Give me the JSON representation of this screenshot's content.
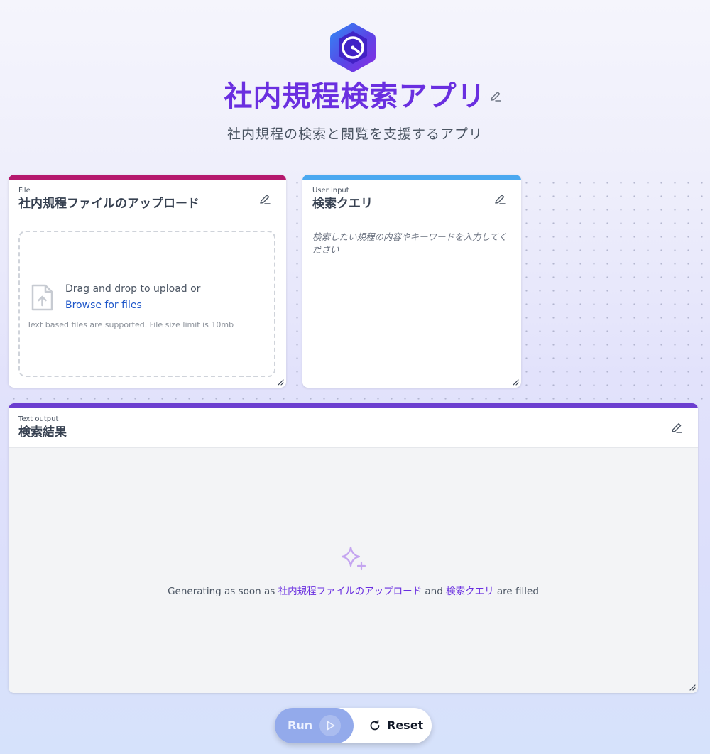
{
  "app": {
    "title": "社内規程検索アプリ",
    "subtitle": "社内規程の検索と閲覧を支援するアプリ",
    "accent": "#6a2fe0"
  },
  "file_card": {
    "kind": "File",
    "title": "社内規程ファイルのアップロード",
    "bar_color": "#b5186d",
    "drop_text": "Drag and drop to upload or",
    "browse_link": "Browse for files",
    "note": "Text based files are supported. File size limit is 10mb"
  },
  "query_card": {
    "kind": "User input",
    "title": "検索クエリ",
    "bar_color": "#4aa8f0",
    "placeholder": "検索したい規程の内容やキーワードを入力してください"
  },
  "output_card": {
    "kind": "Text output",
    "title": "検索結果",
    "bar_color": "#6c3fd0",
    "generating_prefix": "Generating as soon as",
    "field_1": "社内規程ファイルのアップロード",
    "joiner": "and",
    "field_2": "検索クエリ",
    "generating_suffix": "are filled"
  },
  "actions": {
    "run_label": "Run",
    "reset_label": "Reset"
  },
  "icons": {
    "logo": "hexagon-clock-logo-icon",
    "edit": "pencil-icon",
    "file_upload": "file-upload-icon",
    "sparkle": "sparkle-icon",
    "play": "play-icon",
    "reset": "refresh-icon",
    "resize": "resize-handle-icon"
  }
}
